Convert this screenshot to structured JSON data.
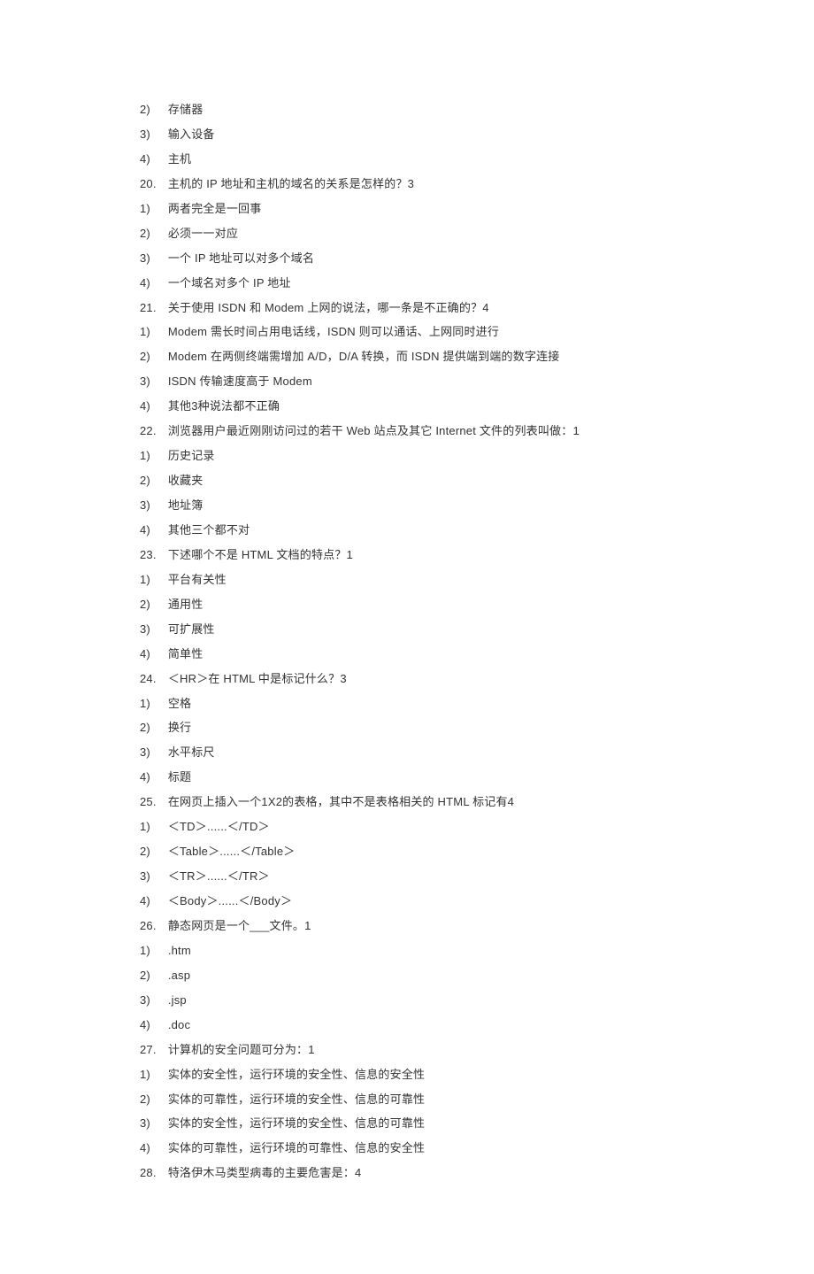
{
  "lines": [
    {
      "marker": "2)",
      "text": "存储器"
    },
    {
      "marker": "3)",
      "text": "输入设备"
    },
    {
      "marker": "4)",
      "text": "主机"
    },
    {
      "marker": "20.",
      "text": "主机的 IP 地址和主机的域名的关系是怎样的？3"
    },
    {
      "marker": "1)",
      "text": "两者完全是一回事"
    },
    {
      "marker": "2)",
      "text": "必须一一对应"
    },
    {
      "marker": "3)",
      "text": "一个 IP 地址可以对多个域名"
    },
    {
      "marker": "4)",
      "text": "一个域名对多个 IP 地址"
    },
    {
      "marker": "21.",
      "text": "关于使用 ISDN 和 Modem 上网的说法，哪一条是不正确的？4"
    },
    {
      "marker": "1)",
      "text": "Modem 需长时间占用电话线，ISDN 则可以通话、上网同时进行"
    },
    {
      "marker": "2)",
      "text": "Modem 在两侧终端需增加 A/D，D/A 转换，而 ISDN 提供端到端的数字连接"
    },
    {
      "marker": "3)",
      "text": "ISDN 传输速度高于 Modem"
    },
    {
      "marker": "4)",
      "text": "其他3种说法都不正确"
    },
    {
      "marker": "22.",
      "text": "浏览器用户最近刚刚访问过的若干 Web 站点及其它 Internet 文件的列表叫做：1"
    },
    {
      "marker": "1)",
      "text": "历史记录"
    },
    {
      "marker": "2)",
      "text": "收藏夹"
    },
    {
      "marker": "3)",
      "text": "地址簿"
    },
    {
      "marker": "4)",
      "text": "其他三个都不对"
    },
    {
      "marker": "23.",
      "text": "下述哪个不是 HTML 文档的特点？1"
    },
    {
      "marker": "1)",
      "text": "平台有关性"
    },
    {
      "marker": "2)",
      "text": "通用性"
    },
    {
      "marker": "3)",
      "text": "可扩展性"
    },
    {
      "marker": "4)",
      "text": "简单性"
    },
    {
      "marker": "24.",
      "text": "＜HR＞在 HTML 中是标记什么？3"
    },
    {
      "marker": "1)",
      "text": "空格"
    },
    {
      "marker": "2)",
      "text": "换行"
    },
    {
      "marker": "3)",
      "text": "水平标尺"
    },
    {
      "marker": "4)",
      "text": "标题"
    },
    {
      "marker": "25.",
      "text": "在网页上插入一个1X2的表格，其中不是表格相关的 HTML 标记有4"
    },
    {
      "marker": "1)",
      "text": "＜TD＞......＜/TD＞"
    },
    {
      "marker": "2)",
      "text": "＜Table＞......＜/Table＞"
    },
    {
      "marker": "3)",
      "text": "＜TR＞......＜/TR＞"
    },
    {
      "marker": "4)",
      "text": "＜Body＞......＜/Body＞"
    },
    {
      "marker": "26.",
      "text": "静态网页是一个___文件。1"
    },
    {
      "marker": "1)",
      "text": ".htm"
    },
    {
      "marker": "2)",
      "text": ".asp"
    },
    {
      "marker": "3)",
      "text": ".jsp"
    },
    {
      "marker": "4)",
      "text": ".doc"
    },
    {
      "marker": "27.",
      "text": "计算机的安全问题可分为：1"
    },
    {
      "marker": "1)",
      "text": "实体的安全性，运行环境的安全性、信息的安全性"
    },
    {
      "marker": "2)",
      "text": "实体的可靠性，运行环境的安全性、信息的可靠性"
    },
    {
      "marker": "3)",
      "text": "实体的安全性，运行环境的安全性、信息的可靠性"
    },
    {
      "marker": "4)",
      "text": "实体的可靠性，运行环境的可靠性、信息的安全性"
    },
    {
      "marker": "28.",
      "text": "特洛伊木马类型病毒的主要危害是：4"
    }
  ]
}
